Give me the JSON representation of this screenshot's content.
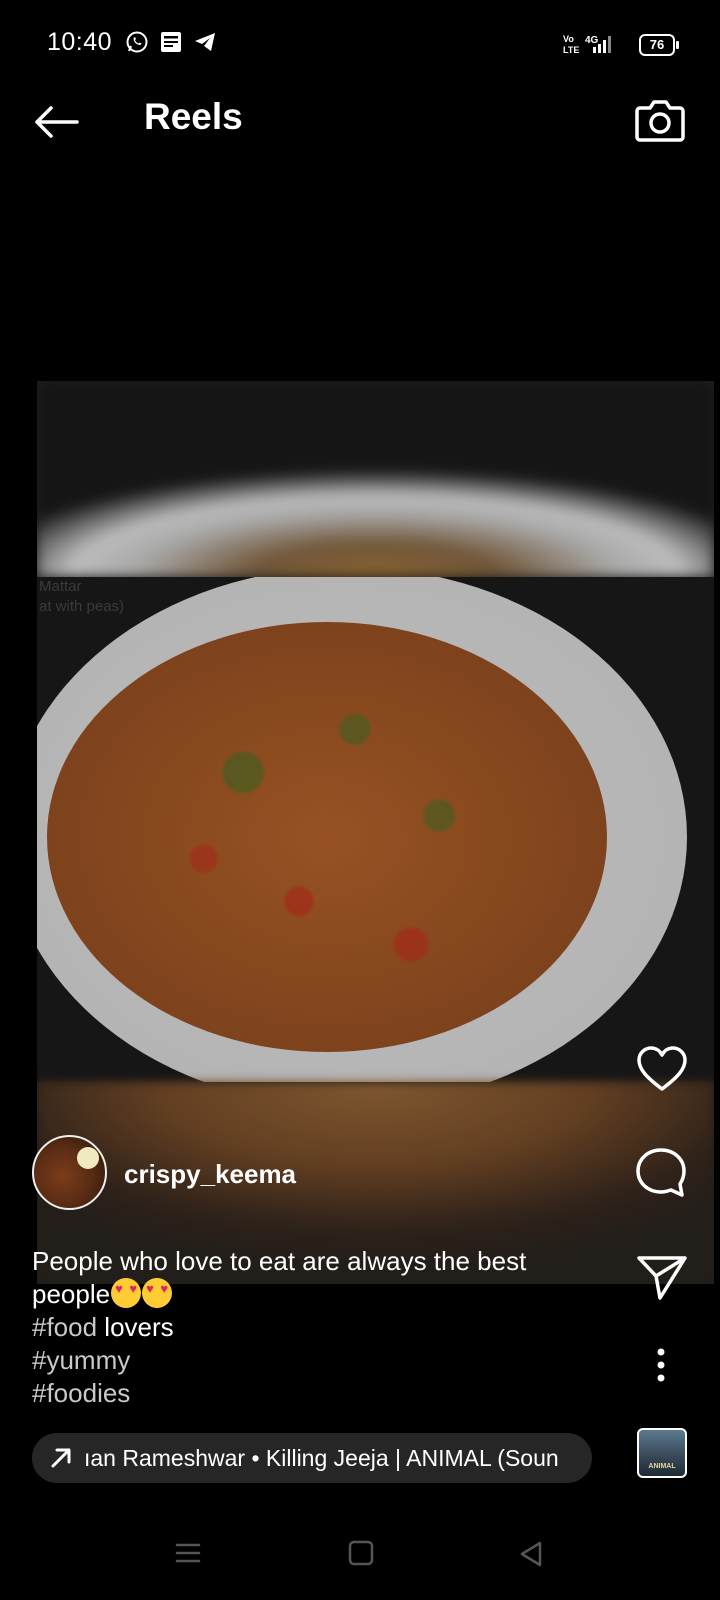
{
  "status_bar": {
    "time": "10:40",
    "battery": "76",
    "network": "4G",
    "icons": [
      "whatsapp-icon",
      "news-icon",
      "telegram-icon",
      "volte-icon",
      "signal-icon",
      "battery-icon"
    ]
  },
  "header": {
    "title": "Reels",
    "back_icon": "arrow-left-icon",
    "camera_icon": "camera-icon"
  },
  "reel": {
    "video_overlay_text": "Mattar\nat with peas)",
    "author": {
      "username": "crispy_keema"
    },
    "caption": {
      "line1": "People who love to eat are always the best people",
      "hashtag1": "#food",
      "hashtag1_tail": " lovers",
      "hashtag2": "#yummy",
      "hashtag3": "#foodies"
    },
    "audio": {
      "text": "ıan Rameshwar • Killing Jeeja | ANIMAL (Soun",
      "thumb_label": "ANIMAL"
    },
    "actions": [
      "like-icon",
      "comment-icon",
      "share-icon",
      "more-icon"
    ]
  },
  "colors": {
    "background": "#000000",
    "text": "#ffffff",
    "hashtag": "#c9c9c9",
    "pill": "#262626"
  }
}
